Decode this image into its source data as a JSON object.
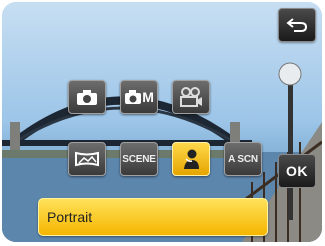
{
  "header": {
    "back_icon": "return-arrow-icon"
  },
  "modes_row1": [
    {
      "id": "auto",
      "icon": "camera-icon"
    },
    {
      "id": "manual",
      "icon": "camera-m-icon",
      "label": "M"
    },
    {
      "id": "movie",
      "icon": "movie-camera-icon"
    }
  ],
  "modes_row2": [
    {
      "id": "panorama",
      "icon": "panorama-icon"
    },
    {
      "id": "scene",
      "label": "SCENE"
    },
    {
      "id": "portrait",
      "icon": "portrait-icon",
      "selected": true
    },
    {
      "id": "auto_scene",
      "label": "A SCN"
    }
  ],
  "ok_label": "OK",
  "current_mode_label": "Portrait",
  "colors": {
    "selected": "#f5b600",
    "button": "#3a3a3a"
  }
}
